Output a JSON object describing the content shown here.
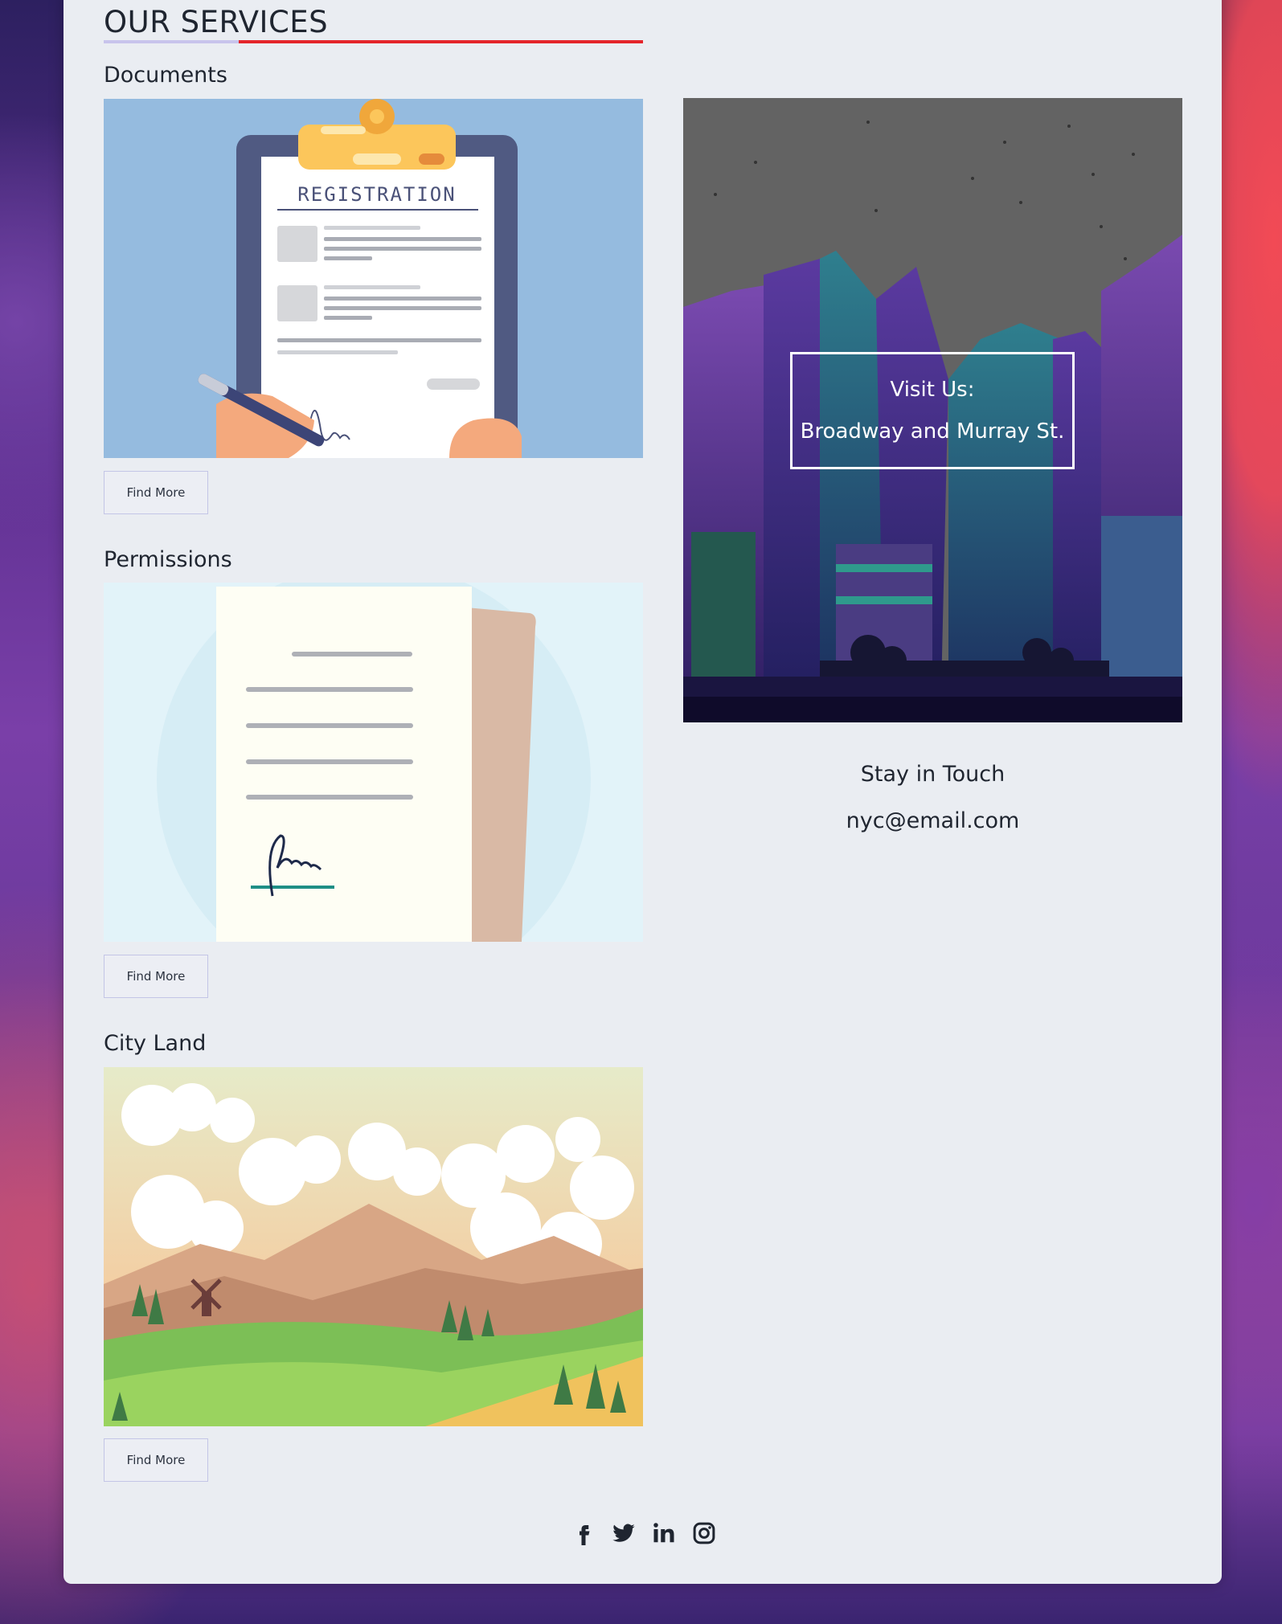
{
  "services": {
    "heading": "OUR SERVICES",
    "items": [
      {
        "title": "Documents",
        "button_label": "Find More",
        "image_text": "REGISTRATION"
      },
      {
        "title": "Permissions",
        "button_label": "Find More"
      },
      {
        "title": "City Land",
        "button_label": "Find More"
      }
    ]
  },
  "visit": {
    "label": "Visit Us:",
    "address": "Broadway and Murray St."
  },
  "contact": {
    "heading": "Stay in Touch",
    "email": "nyc@email.com"
  },
  "social": [
    "facebook-icon",
    "twitter-icon",
    "linkedin-icon",
    "instagram-icon"
  ],
  "colors": {
    "accent_red": "#e4252b",
    "accent_lilac": "#c8c4ec",
    "card_bg": "#eaedf2"
  }
}
